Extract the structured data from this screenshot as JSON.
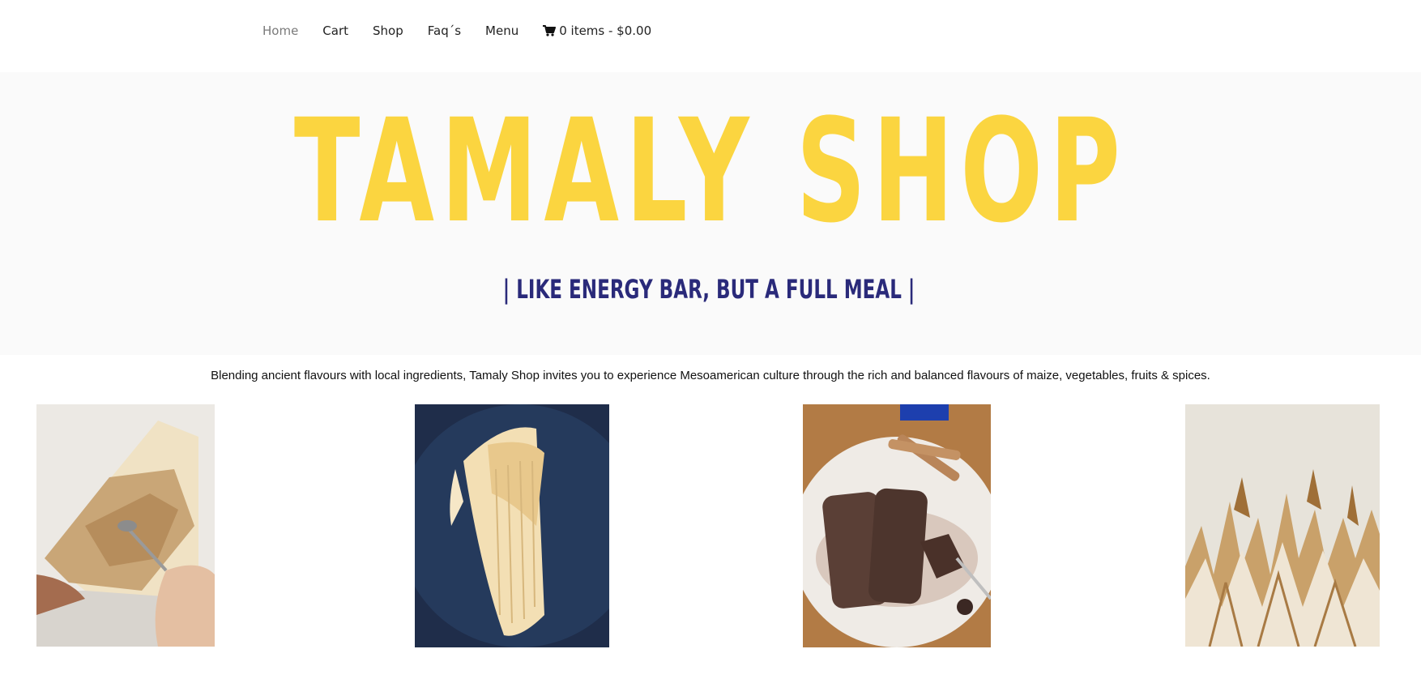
{
  "nav": {
    "items": [
      {
        "label": "Home",
        "active": true
      },
      {
        "label": "Cart",
        "active": false
      },
      {
        "label": "Shop",
        "active": false
      },
      {
        "label": "Faq´s",
        "active": false
      },
      {
        "label": "Menu",
        "active": false
      }
    ],
    "cart_summary": "0 items - $0.00",
    "cart_icon": "shopping-cart-icon"
  },
  "hero": {
    "title": "TAMALY SHOP",
    "tagline": "| LIKE ENERGY BAR, BUT A FULL MEAL |",
    "title_color": "#fbd540",
    "tagline_color": "#2a2a7a",
    "background": "#fafafa"
  },
  "intro": {
    "text": "Blending ancient flavours with local ingredients, Tamaly Shop invites you to experience Mesoamerican culture through the rich and balanced flavours of maize, vegetables, fruits & spices."
  },
  "gallery": [
    {
      "subject": "tamale-opened-with-spoon"
    },
    {
      "subject": "wrapped-tamale-on-dark-plate"
    },
    {
      "subject": "chocolate-tamales-with-cinnamon"
    },
    {
      "subject": "corn-husks-standing"
    }
  ]
}
